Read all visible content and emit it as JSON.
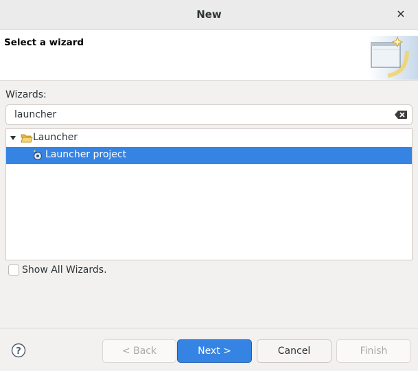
{
  "window": {
    "title": "New",
    "close_icon": "close-icon"
  },
  "banner": {
    "title": "Select a wizard",
    "graphic_icon": "new-wizard-banner-icon"
  },
  "wizards": {
    "label": "Wizards:",
    "filter_value": "launcher",
    "clear_icon": "clear-text-icon"
  },
  "tree": {
    "items": [
      {
        "label": "Launcher",
        "icon": "folder-open-icon",
        "expanded": true
      },
      {
        "label": "Launcher project",
        "icon": "launcher-project-icon",
        "selected": true
      }
    ]
  },
  "show_all": {
    "label": "Show All Wizards.",
    "checked": false
  },
  "buttons": {
    "help_icon": "help-icon",
    "back": "< Back",
    "next": "Next >",
    "cancel": "Cancel",
    "finish": "Finish"
  },
  "colors": {
    "selection": "#3584e4",
    "accent": "#3584e4"
  }
}
